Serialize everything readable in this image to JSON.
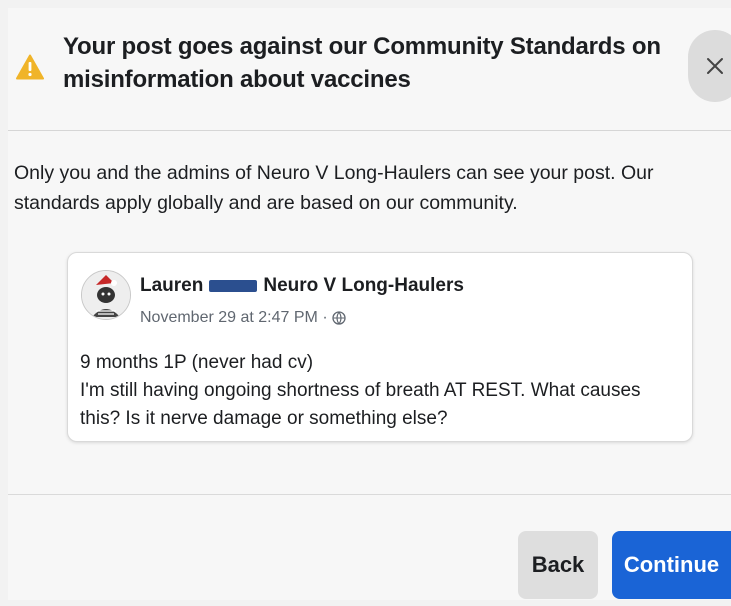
{
  "dialog": {
    "title": "Your post goes against our Community Standards on misinformation about vaccines",
    "warning_icon": "warning-triangle-icon",
    "close_icon": "close-icon",
    "body": "Only you and the admins of Neuro V Long-Haulers can see your post. Our standards apply globally and are based on our community."
  },
  "post": {
    "author": "Lauren",
    "group": "Neuro V Long-Haulers",
    "timestamp": "November 29 at 2:47 PM ·",
    "privacy_icon": "globe-icon",
    "line1": "9 months 1P (never had cv)",
    "line2": "I'm still having ongoing shortness of breath AT REST. What causes this? Is it nerve damage or something else?"
  },
  "footer": {
    "back_label": "Back",
    "continue_label": "Continue"
  },
  "colors": {
    "warning": "#f0b429",
    "primary": "#1a64d6",
    "redaction": "#2b4f8f"
  }
}
